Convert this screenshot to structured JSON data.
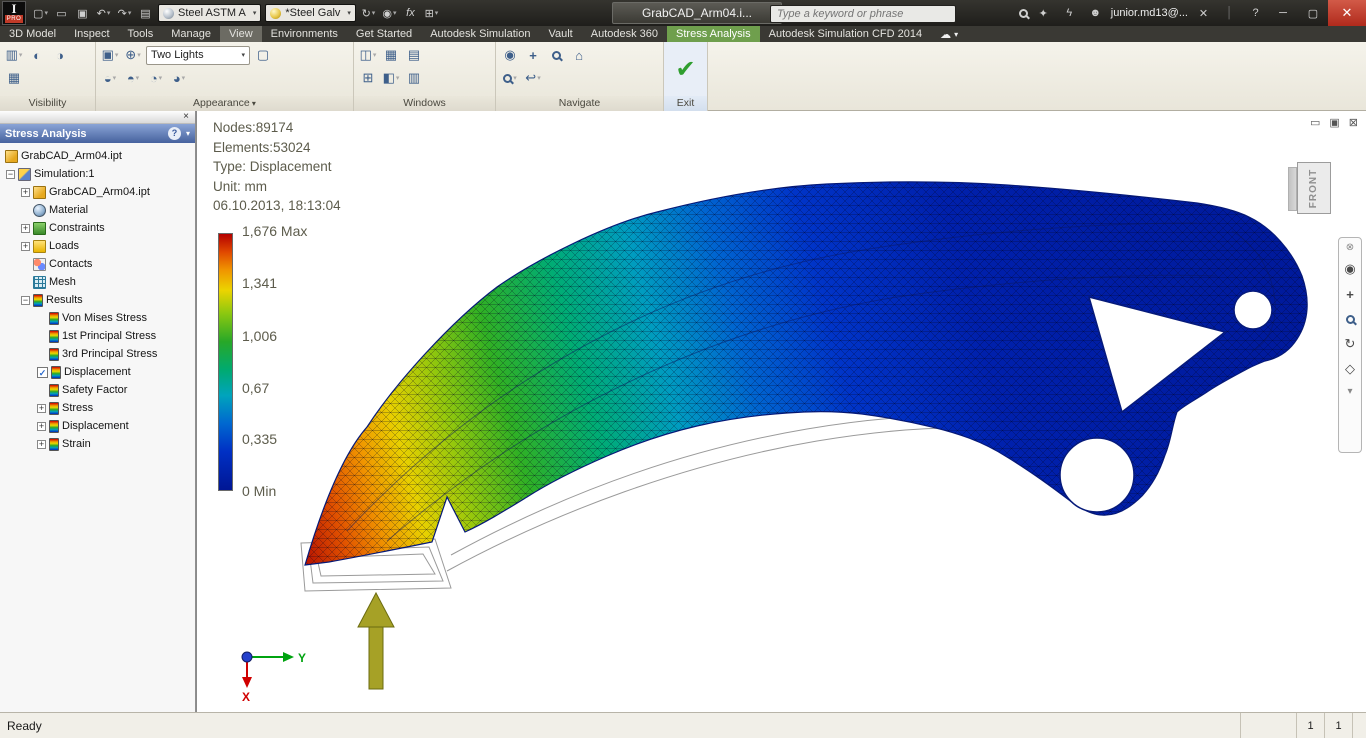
{
  "titlebar": {
    "badge_top": "I",
    "badge_bottom": "PRO",
    "material_combo": "Steel ASTM A",
    "finish_combo": "*Steel Galv",
    "doc_title": "GrabCAD_Arm04.i...",
    "search_placeholder": "Type a keyword or phrase",
    "user_label": "junior.md13@..."
  },
  "tabs": [
    "3D Model",
    "Inspect",
    "Tools",
    "Manage",
    "View",
    "Environments",
    "Get Started",
    "Autodesk Simulation",
    "Vault",
    "Autodesk 360",
    "Stress Analysis",
    "Autodesk Simulation CFD 2014"
  ],
  "ribbon": {
    "groups": [
      "Visibility",
      "Appearance",
      "Windows",
      "Navigate",
      "Exit"
    ],
    "two_lights_combo": "Two Lights"
  },
  "browser": {
    "panel_title": "Stress Analysis",
    "tree": [
      {
        "label": "GrabCAD_Arm04.ipt"
      },
      {
        "label": "Simulation:1"
      },
      {
        "label": "GrabCAD_Arm04.ipt"
      },
      {
        "label": "Material"
      },
      {
        "label": "Constraints"
      },
      {
        "label": "Loads"
      },
      {
        "label": "Contacts"
      },
      {
        "label": "Mesh"
      },
      {
        "label": "Results"
      },
      {
        "label": "Von Mises Stress"
      },
      {
        "label": "1st Principal Stress"
      },
      {
        "label": "3rd Principal Stress"
      },
      {
        "label": "Displacement"
      },
      {
        "label": "Safety Factor"
      },
      {
        "label": "Stress"
      },
      {
        "label": "Displacement"
      },
      {
        "label": "Strain"
      }
    ]
  },
  "viewport": {
    "info": [
      "Nodes:89174",
      "Elements:53024",
      "Type: Displacement",
      "Unit: mm",
      "06.10.2013, 18:13:04"
    ],
    "legend": [
      "1,676 Max",
      "1,341",
      "1,006",
      "0,67",
      "0,335",
      "0 Min"
    ],
    "fringe_colors": [
      "#b40000",
      "#f09400",
      "#ecd400",
      "#28a828",
      "#00a4bc",
      "#001694"
    ],
    "viewcube_label": "FRONT",
    "triad_x": "X",
    "triad_y": "Y"
  },
  "statusbar": {
    "message": "Ready",
    "cells": [
      "1",
      "1"
    ]
  },
  "icons": {
    "new": "▢",
    "open": "▭",
    "save": "▣",
    "undo": "↶",
    "redo": "↷",
    "print": "▤",
    "sync": "↻",
    "globe": "◉",
    "fx": "fx",
    "star": "✦",
    "lightning": "ϟ",
    "person": "☻",
    "signout": "✕",
    "help": "?",
    "sep": "│",
    "min": "─",
    "max": "▢",
    "close": "✕",
    "cloud": "☁",
    "cloud_dd": "▾",
    "vis1": "▥",
    "vis2": "◐",
    "vis3": "◑",
    "vis4": "▦",
    "app1": "▣",
    "app2": "⊕",
    "app3": "▢",
    "sh1": "◒",
    "sh2": "◓",
    "sh3": "◔",
    "sh4": "◕",
    "win1": "◫",
    "win2": "▦",
    "win3": "▤",
    "win4": "⊞",
    "win5": "◧",
    "win6": "▥",
    "nav_x": "⊗",
    "nav_wheel": "◉",
    "nav_pan": "+",
    "nav_home": "⌂",
    "nav_prev": "↩",
    "nav_orbit": "↻",
    "nav_look": "◇",
    "nav_dd": "▾",
    "check": "✔",
    "grip_x": "×",
    "q": "?",
    "vp_min": "▭",
    "vp_rest": "▣",
    "vp_close": "⊠"
  }
}
